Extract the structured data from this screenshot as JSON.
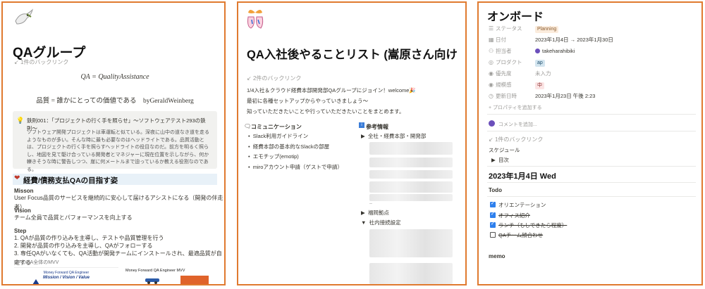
{
  "panel1": {
    "title": "QAグループ",
    "backlink": "1件のバックリンク",
    "formula1": "QA = QualityAssistance",
    "formula2": "品質 = 誰かにとっての価値である　byGeraldWeinberg",
    "callout_title": "鉄則001：「プロジェクトの行く手を照らせ」〜ソフトウェアテスト293の鉄則〜",
    "callout_body": "ソフトウェア開発プロジェクトは車運転と似ている。深夜に山中の道なき道を走るようなものが多い。そんな時に最も必要なのはヘッドライトである。品質活動とは、プロジェクトの行く手を照らすヘッドライトの役目なのだ。前方を明るく照らし、地図を見て駆け合っている開発者とマネジャーに現在位置を示しながら、何か轢きそうな時に警告しつつ、崖に何メートルまで迫っているか教える役割なのである。",
    "section_heading": "経費/債務支払QAの目指す姿",
    "mission_label": "Misson",
    "mission_text": "User Focus品質のサービスを継続的に安心して届けるアシストになる（開発の伴走者）",
    "vision_label": "Vision",
    "vision_text": "チーム全員で品質とパフォーマンスを向上する",
    "step_label": "Step",
    "steps": [
      "1.  QAが品質の作り込みを主導し、テストや品質管理を行う",
      "2.  開発が品質の作り込みを主導し、QAがフォローする",
      "3.  専任QAがいなくても、QA活動が開発チームにインストールされ、最適品質が自走する"
    ],
    "mvv_link": "MFのQA全体のMVV",
    "img1_line1": "Money Forward QA Engineer",
    "img1_line2": "Mission / Vision / Value",
    "img2_title": "Money Forward QA Engineer MVV"
  },
  "panel2": {
    "title": "QA入社後やることリスト (嵩原さん向け",
    "backlink": "2件のバックリンク",
    "intro1": "1/4入社＆クラウド経費本部開発部QAグループにジョイン！welcome🎉",
    "intro2": "最初に各種セットアップからやっていきましょう〜",
    "intro3": "知っていただきたいことや行っていただきたいことをまとめます。",
    "comm_heading": "コミュニケーション",
    "comm_items": [
      "Slack利用ガイドライン",
      "経費本部の基本的なSlackの部屋",
      "エモチップ(emotip)",
      "miroアカウント申請（ゲストで申請）"
    ],
    "ref_heading": "参考情報",
    "ref_toggle1": "全社・経費本部・開発部",
    "ref_toggle2": "福岡拠点",
    "ref_toggle3": "社内接続設定",
    "dash": "--"
  },
  "panel3": {
    "title": "オンボード",
    "props": [
      {
        "icon": "☰",
        "label": "ステータス",
        "value": "Planning",
        "kind": "tag",
        "color": "#fbecdd",
        "text_color": "#8a5a2b"
      },
      {
        "icon": "▦",
        "label": "日付",
        "value": "2023年1月4日 → 2023年1月30日",
        "kind": "text"
      },
      {
        "icon": "👥",
        "label": "担当者",
        "value": "takeharahibiki",
        "kind": "person"
      },
      {
        "icon": "◎",
        "label": "プロダクト",
        "value": "ap",
        "kind": "tag",
        "color": "#d3e5ef",
        "text_color": "#1f4e6e"
      },
      {
        "icon": "◉",
        "label": "優先度",
        "value": "未入力",
        "kind": "muted"
      },
      {
        "icon": "◉",
        "label": "規模感",
        "value": "中",
        "kind": "tag",
        "color": "#fbe4e4",
        "text_color": "#8a2b2b"
      },
      {
        "icon": "◷",
        "label": "更新日時",
        "value": "2023年1月23日 午後 2:23",
        "kind": "text"
      }
    ],
    "add_property": "+ プロパティを追加する",
    "comment_placeholder": "コメントを追加...",
    "backlink": "1件のバックリンク",
    "schedule": "スケジュール",
    "toc": "目次",
    "date_heading": "2023年1月4日 Wed",
    "todo_heading": "Todo",
    "todos": [
      {
        "text": "オリエンテーション",
        "checked": true,
        "struck": false
      },
      {
        "text": "オフィス紹介",
        "checked": true,
        "struck": true
      },
      {
        "text": "ランチ（もしできたら程度）",
        "checked": true,
        "struck": true
      },
      {
        "text": "QAチーム顔合わせ",
        "checked": false,
        "struck": true
      }
    ],
    "memo": "memo"
  },
  "colors": {
    "panel_border": "#e07a2f",
    "callout_bg": "#f1f1ef",
    "section_bg": "#e8f1f8",
    "check_blue": "#2f80ed"
  }
}
